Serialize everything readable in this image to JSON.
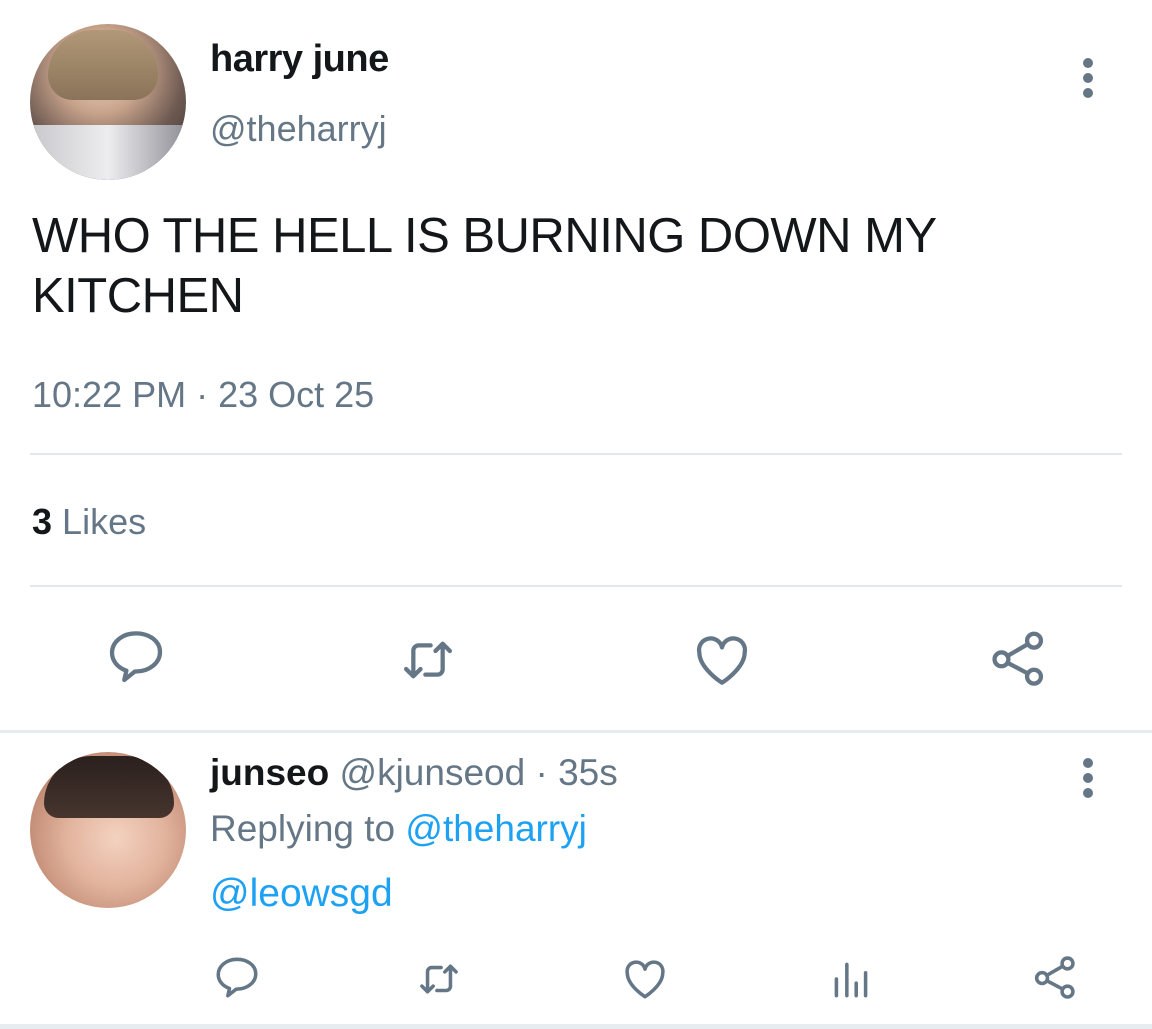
{
  "tweet": {
    "author_name": "harry june",
    "author_handle": "@theharryj",
    "text": "WHO THE HELL IS BURNING DOWN MY KITCHEN",
    "timestamp": "10:22 PM · 23 Oct 25",
    "likes_count": "3",
    "likes_label": "Likes",
    "actions": [
      "reply-icon",
      "retweet-icon",
      "like-icon",
      "share-icon"
    ],
    "more_icon": "more-vertical-icon"
  },
  "reply": {
    "author_name": "junseo",
    "author_handle": "@kjunseod",
    "separator": "·",
    "age": "35s",
    "replying_prefix": "Replying to",
    "replying_to": "@theharryj",
    "text": "@leowsgd",
    "actions": [
      "reply-icon",
      "retweet-icon",
      "like-icon",
      "analytics-icon",
      "share-icon"
    ],
    "more_icon": "more-vertical-icon"
  },
  "colors": {
    "primary_text": "#14171a",
    "secondary_text": "#657786",
    "link": "#1da1f2",
    "divider": "#e1e8ed"
  }
}
